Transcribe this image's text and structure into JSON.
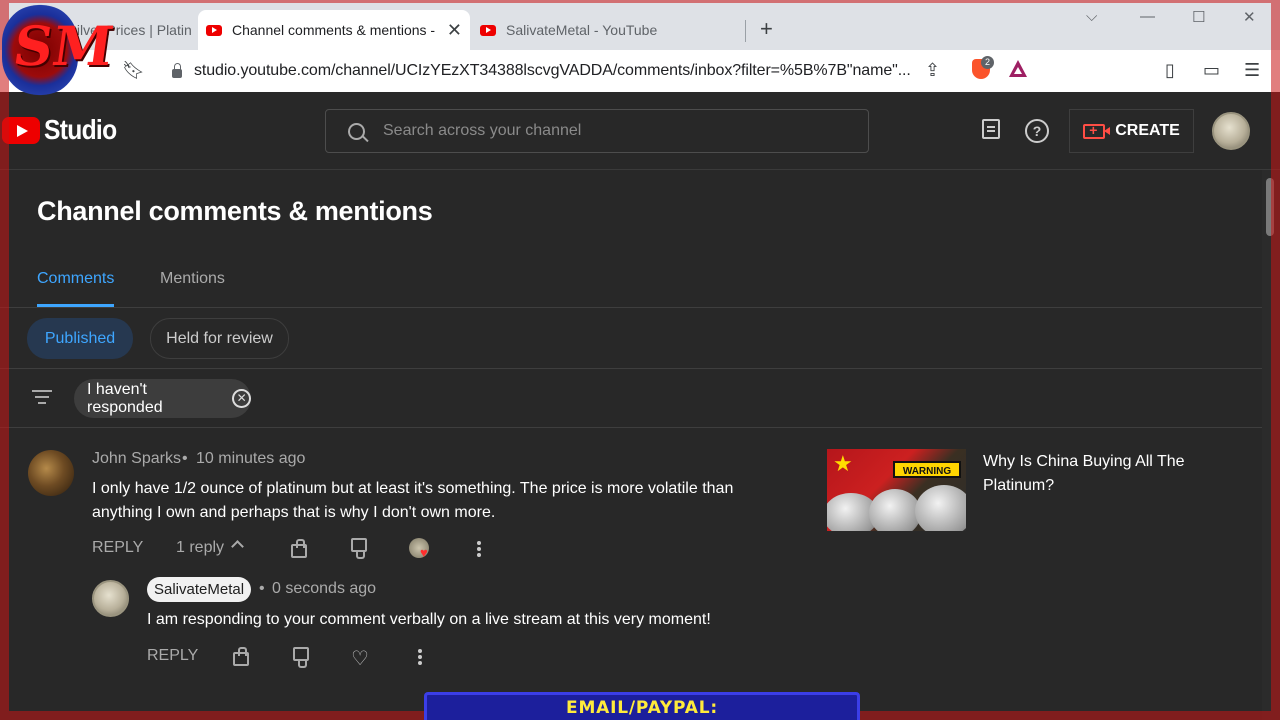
{
  "browser": {
    "tabs": [
      {
        "title": "| Silver Prices | Platin"
      },
      {
        "title": "Channel comments & mentions -"
      },
      {
        "title": "SalivateMetal - YouTube"
      }
    ],
    "url": "studio.youtube.com/channel/UCIzYEzXT34388lscvgVADDA/comments/inbox?filter=%5B%7B\"name\"...",
    "extension_badge": "2"
  },
  "studio": {
    "logo_text": "Studio",
    "search_placeholder": "Search across your channel",
    "create_label": "CREATE"
  },
  "page": {
    "title": "Channel comments & mentions",
    "tabs": [
      "Comments",
      "Mentions"
    ],
    "active_tab": "Comments",
    "chips": [
      "Published",
      "Held for review"
    ],
    "active_chip": "Published",
    "filter": "I haven't responded"
  },
  "comment": {
    "author": "John Sparks",
    "time": "10 minutes ago",
    "text": "I only have 1/2 ounce of platinum but at least it's something.  The price is more volatile than anything I own and perhaps that is why I don't own more.",
    "reply_label": "REPLY",
    "replies_label": "1 reply",
    "video_title": "Why Is China Buying All The Platinum?",
    "thumb_warning": "WARNING"
  },
  "reply": {
    "author": "SalivateMetal",
    "time": "0 seconds ago",
    "text": "I am responding to your comment verbally on a live stream at this very moment!",
    "reply_label": "REPLY"
  },
  "overlay": {
    "banner": "EMAIL/PAYPAL: SALIVATEMETAL@GMAIL.COM",
    "logo": "SM"
  },
  "colors": {
    "accent": "#3ea6ff",
    "youtube_red": "#ff0000",
    "background": "#282828",
    "banner_text": "#ffeb3b"
  }
}
